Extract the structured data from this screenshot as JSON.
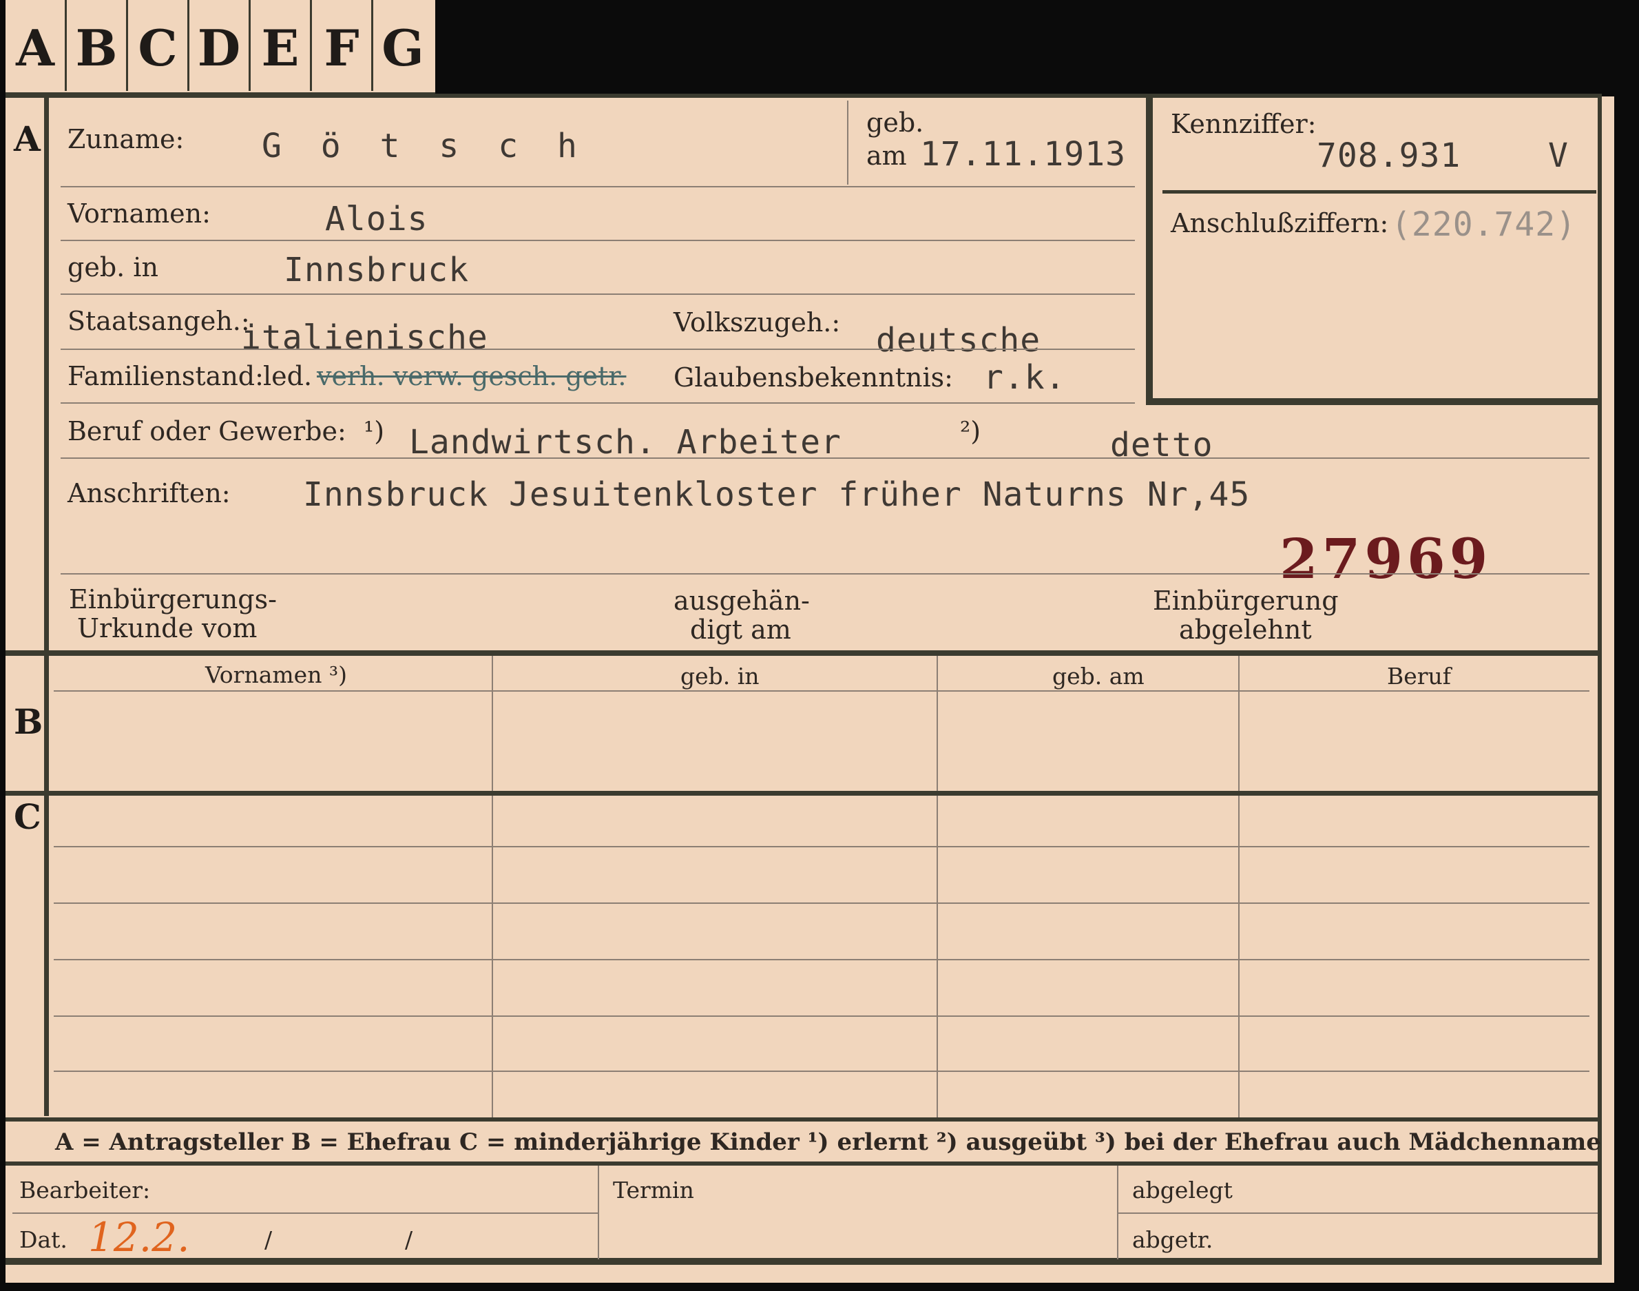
{
  "tabs": [
    "A",
    "B",
    "C",
    "D",
    "E",
    "F",
    "G"
  ],
  "sections": {
    "a": "A",
    "b": "B",
    "c": "C"
  },
  "header": {
    "surname_label": "Zuname:",
    "surname_value": "G ö t s c h",
    "born_label_1": "geb.",
    "born_label_2": "am",
    "born_value": "17.11.1913",
    "id_label": "Kennziffer:",
    "id_value": "708.931",
    "id_suffix": "V",
    "link_label": "Anschlußziffern:",
    "link_value": "(220.742)"
  },
  "fields": {
    "first_names_label": "Vornamen:",
    "first_names_value": "Alois",
    "birthplace_label": "geb. in",
    "birthplace_value": "Innsbruck",
    "citizenship_label": "Staatsangeh.:",
    "citizenship_value": "italienische",
    "ethnicity_label": "Volkszugeh.:",
    "ethnicity_value": "deutsche",
    "marital_label": "Familienstand:",
    "marital_value": "led.",
    "marital_struck": "verh. verw. gesch. getr.",
    "religion_label": "Glaubensbekenntnis:",
    "religion_value": "r.k.",
    "occupation_label": "Beruf oder Gewerbe:",
    "occupation_mark1": "¹)",
    "occupation_value": "Landwirtsch. Arbeiter",
    "occupation_mark2": "²)",
    "occupation_value2": "detto",
    "address_label": "Anschriften:",
    "address_value": "Innsbruck Jesuitenkloster  früher Naturns Nr,45",
    "stamp_number": "27969",
    "naturalization_label_1": "Einbürgerungs-",
    "naturalization_label_2": "Urkunde vom",
    "handed_label_1": "ausgehän-",
    "handed_label_2": "digt am",
    "rejected_label_1": "Einbürgerung",
    "rejected_label_2": "abgelehnt"
  },
  "table_headers": [
    "Vornamen ³)",
    "geb. in",
    "geb. am",
    "Beruf"
  ],
  "legend": "A = Antragsteller   B = Ehefrau   C = minderjährige Kinder   ¹) erlernt   ²) ausgeübt   ³) bei der Ehefrau auch Mädchenname",
  "footer": {
    "clerk_label": "Bearbeiter:",
    "date_label": "Dat.",
    "date_value": "12.2.",
    "slash1": "/",
    "slash2": "/",
    "term_label": "Termin",
    "filed_label": "abgelegt",
    "filed2_label": "abgetr."
  }
}
